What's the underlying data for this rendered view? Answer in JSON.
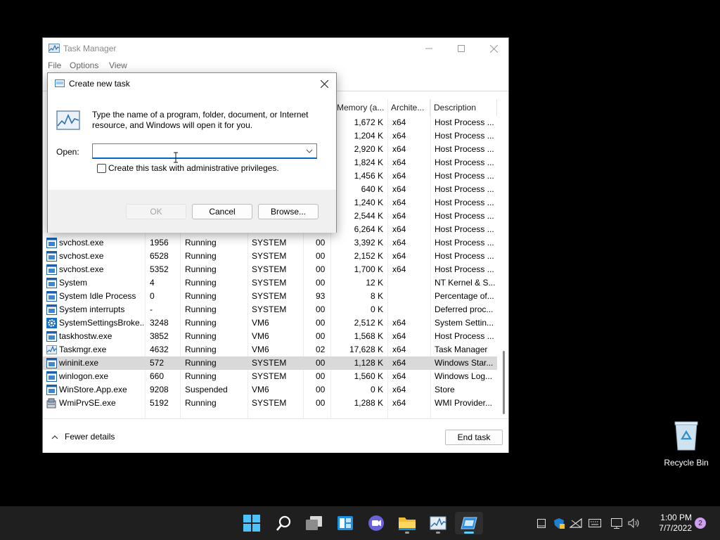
{
  "task_manager": {
    "title": "Task Manager",
    "menu": [
      "File",
      "Options",
      "View"
    ],
    "columns": [
      "Memory (a...",
      "Archite...",
      "Description"
    ],
    "partial_rows": [
      {
        "memory": "1,672 K",
        "arch": "x64",
        "desc": "Host Process ..."
      },
      {
        "memory": "1,204 K",
        "arch": "x64",
        "desc": "Host Process ..."
      },
      {
        "memory": "2,920 K",
        "arch": "x64",
        "desc": "Host Process ..."
      },
      {
        "memory": "1,824 K",
        "arch": "x64",
        "desc": "Host Process ..."
      },
      {
        "memory": "1,456 K",
        "arch": "x64",
        "desc": "Host Process ..."
      },
      {
        "memory": "640 K",
        "arch": "x64",
        "desc": "Host Process ..."
      },
      {
        "memory": "1,240 K",
        "arch": "x64",
        "desc": "Host Process ..."
      },
      {
        "memory": "2,544 K",
        "arch": "x64",
        "desc": "Host Process ..."
      },
      {
        "memory": "6,264 K",
        "arch": "x64",
        "desc": "Host Process ..."
      }
    ],
    "rows": [
      {
        "name": "svchost.exe",
        "pid": "1956",
        "status": "Running",
        "user": "SYSTEM",
        "cpu": "00",
        "memory": "3,392 K",
        "arch": "x64",
        "desc": "Host Process ...",
        "icon": "service-icon"
      },
      {
        "name": "svchost.exe",
        "pid": "6528",
        "status": "Running",
        "user": "SYSTEM",
        "cpu": "00",
        "memory": "2,152 K",
        "arch": "x64",
        "desc": "Host Process ...",
        "icon": "service-icon"
      },
      {
        "name": "svchost.exe",
        "pid": "5352",
        "status": "Running",
        "user": "SYSTEM",
        "cpu": "00",
        "memory": "1,700 K",
        "arch": "x64",
        "desc": "Host Process ...",
        "icon": "service-icon"
      },
      {
        "name": "System",
        "pid": "4",
        "status": "Running",
        "user": "SYSTEM",
        "cpu": "00",
        "memory": "12 K",
        "arch": "",
        "desc": "NT Kernel & S...",
        "icon": "service-icon"
      },
      {
        "name": "System Idle Process",
        "pid": "0",
        "status": "Running",
        "user": "SYSTEM",
        "cpu": "93",
        "memory": "8 K",
        "arch": "",
        "desc": "Percentage of...",
        "icon": "service-icon"
      },
      {
        "name": "System interrupts",
        "pid": "-",
        "status": "Running",
        "user": "SYSTEM",
        "cpu": "00",
        "memory": "0 K",
        "arch": "",
        "desc": "Deferred proc...",
        "icon": "service-icon"
      },
      {
        "name": "SystemSettingsBroke...",
        "pid": "3248",
        "status": "Running",
        "user": "VM6",
        "cpu": "00",
        "memory": "2,512 K",
        "arch": "x64",
        "desc": "System Settin...",
        "icon": "gear-icon"
      },
      {
        "name": "taskhostw.exe",
        "pid": "3852",
        "status": "Running",
        "user": "VM6",
        "cpu": "00",
        "memory": "1,568 K",
        "arch": "x64",
        "desc": "Host Process ...",
        "icon": "service-icon"
      },
      {
        "name": "Taskmgr.exe",
        "pid": "4632",
        "status": "Running",
        "user": "VM6",
        "cpu": "02",
        "memory": "17,628 K",
        "arch": "x64",
        "desc": "Task Manager",
        "icon": "taskmgr-icon"
      },
      {
        "name": "wininit.exe",
        "pid": "572",
        "status": "Running",
        "user": "SYSTEM",
        "cpu": "00",
        "memory": "1,128 K",
        "arch": "x64",
        "desc": "Windows Star...",
        "icon": "service-icon",
        "selected": true
      },
      {
        "name": "winlogon.exe",
        "pid": "660",
        "status": "Running",
        "user": "SYSTEM",
        "cpu": "00",
        "memory": "1,560 K",
        "arch": "x64",
        "desc": "Windows Log...",
        "icon": "service-icon"
      },
      {
        "name": "WinStore.App.exe",
        "pid": "9208",
        "status": "Suspended",
        "user": "VM6",
        "cpu": "00",
        "memory": "0 K",
        "arch": "x64",
        "desc": "Store",
        "icon": "service-icon"
      },
      {
        "name": "WmiPrvSE.exe",
        "pid": "5192",
        "status": "Running",
        "user": "SYSTEM",
        "cpu": "00",
        "memory": "1,288 K",
        "arch": "x64",
        "desc": "WMI Provider...",
        "icon": "wmi-icon"
      }
    ],
    "fewer_details_label": "Fewer details",
    "end_task_label": "End task"
  },
  "run_dialog": {
    "title": "Create new task",
    "description": "Type the name of a program, folder, document, or Internet resource, and Windows will open it for you.",
    "open_label": "Open:",
    "open_value": "",
    "admin_checkbox_label": "Create this task with administrative privileges.",
    "ok_label": "OK",
    "cancel_label": "Cancel",
    "browse_label": "Browse..."
  },
  "desktop": {
    "recycle_bin_label": "Recycle Bin"
  },
  "taskbar": {
    "time": "1:00 PM",
    "date": "7/7/2022",
    "notification_count": "2",
    "accent_color": "#60cdff"
  }
}
